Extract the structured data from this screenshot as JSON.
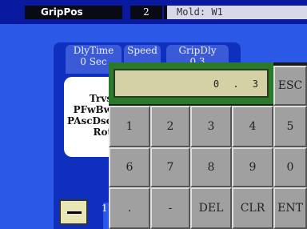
{
  "header": {
    "title": "GripPos",
    "page_number": "2",
    "mold": "Mold: W1"
  },
  "tabs": [
    {
      "label": "DlyTime",
      "value": "0 Sec"
    },
    {
      "label": "Speed",
      "value": ""
    },
    {
      "label": "GripDly",
      "value": "0.3"
    }
  ],
  "states": [
    "Trvs",
    "PFwBw",
    "PAscDsc",
    "Rot"
  ],
  "bottom": {
    "number_hint": "1"
  },
  "keypad": {
    "display": "0 . 3",
    "keys": [
      "ESC",
      "1",
      "2",
      "3",
      "4",
      "5",
      "6",
      "7",
      "8",
      "9",
      "0",
      ".",
      "-",
      "DEL",
      "CLR",
      "ENT"
    ]
  }
}
